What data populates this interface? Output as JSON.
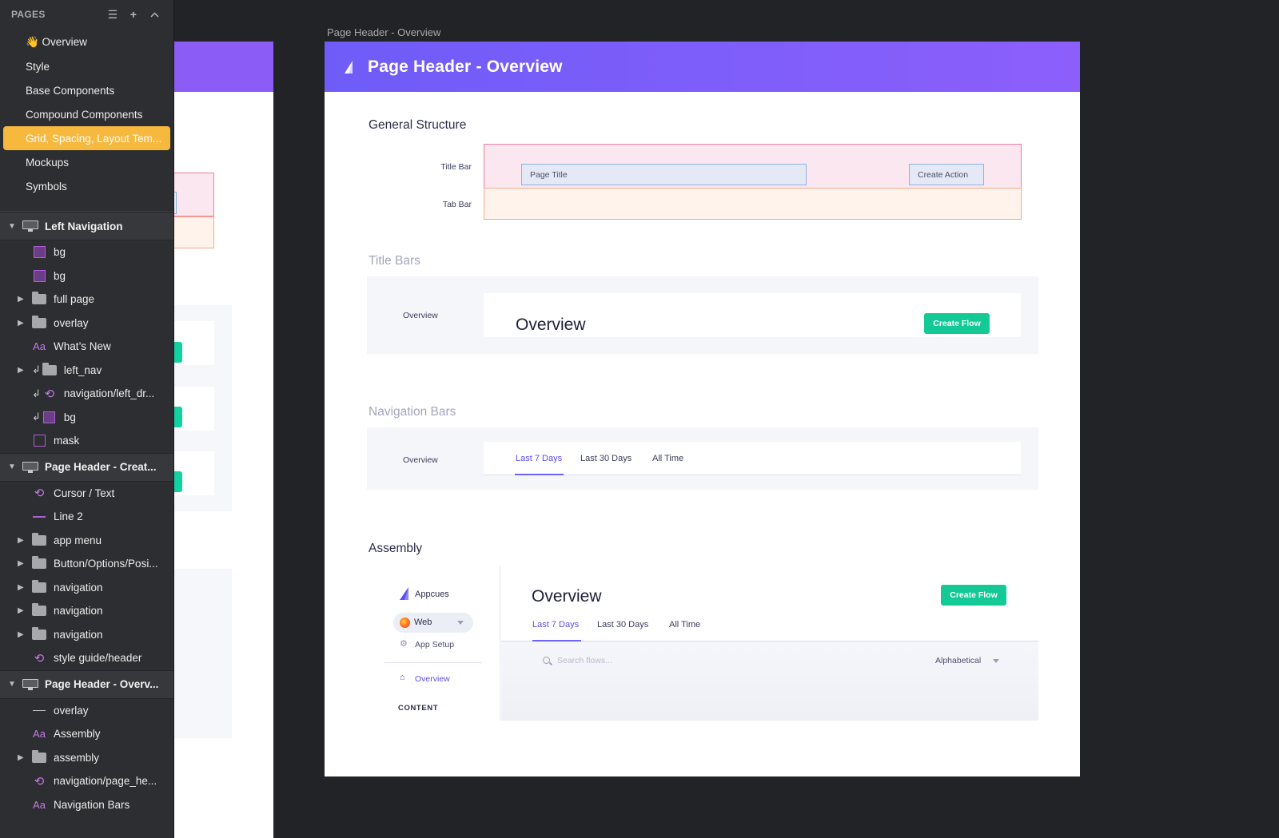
{
  "sidebar": {
    "pages_title": "PAGES",
    "pages": [
      {
        "label": "👋 Overview",
        "active": false
      },
      {
        "label": "Style",
        "active": false
      },
      {
        "label": "Base Components",
        "active": false
      },
      {
        "label": "Compound Components",
        "active": false
      },
      {
        "label": "Grid, Spacing, Layout Tem...",
        "active": true
      },
      {
        "label": "Mockups",
        "active": false
      },
      {
        "label": "Symbols",
        "active": false
      }
    ],
    "groups": [
      {
        "title": "Left Navigation",
        "layers": [
          {
            "label": "bg",
            "icon": "rectangle-icon"
          },
          {
            "label": "bg",
            "icon": "rectangle-icon"
          },
          {
            "label": "full page",
            "icon": "folder-icon"
          },
          {
            "label": "overlay",
            "icon": "folder-icon"
          },
          {
            "label": "What’s New",
            "icon": "text-layer-icon"
          },
          {
            "label": "left_nav",
            "icon": "folder-icon"
          },
          {
            "label": "navigation/left_dr...",
            "icon": "symbol-icon"
          },
          {
            "label": "bg",
            "icon": "rectangle-icon"
          },
          {
            "label": "mask",
            "icon": "rectangle-icon"
          }
        ]
      },
      {
        "title": "Page Header - Creat...",
        "layers": [
          {
            "label": "Cursor / Text",
            "icon": "symbol-icon"
          },
          {
            "label": "Line 2",
            "icon": "line-icon"
          },
          {
            "label": "app menu",
            "icon": "folder-icon"
          },
          {
            "label": "Button/Options/Posi...",
            "icon": "folder-icon"
          },
          {
            "label": "navigation",
            "icon": "folder-icon"
          },
          {
            "label": "navigation",
            "icon": "folder-icon"
          },
          {
            "label": "navigation",
            "icon": "folder-icon"
          },
          {
            "label": "style guide/header",
            "icon": "symbol-icon"
          }
        ]
      },
      {
        "title": "Page Header - Overv...",
        "layers": [
          {
            "label": "overlay",
            "icon": "line-icon"
          },
          {
            "label": "Assembly",
            "icon": "text-layer-icon"
          },
          {
            "label": "assembly",
            "icon": "folder-icon"
          },
          {
            "label": "navigation/page_he...",
            "icon": "symbol-icon"
          },
          {
            "label": "Navigation Bars",
            "icon": "text-layer-icon"
          }
        ]
      }
    ]
  },
  "canvas": {
    "artboard_label": "Page Header - Overview",
    "header_title": "Page Header - Overview",
    "general_structure": {
      "title": "General Structure",
      "title_bar_label": "Title Bar",
      "tab_bar_label": "Tab Bar",
      "page_title_box": "Page Title",
      "create_action_box": "Create Action"
    },
    "title_bars": {
      "title": "Title Bars",
      "row_label": "Overview",
      "heading": "Overview",
      "button": "Create Flow"
    },
    "navigation_bars": {
      "title": "Navigation Bars",
      "row_label": "Overview",
      "tabs": [
        "Last 7 Days",
        "Last 30 Days",
        "All Time"
      ]
    },
    "assembly": {
      "title": "Assembly",
      "brand": "Appcues",
      "platform": "Web",
      "app_setup": "App Setup",
      "nav_overview": "Overview",
      "content_heading": "CONTENT",
      "heading": "Overview",
      "button": "Create Flow",
      "tabs": [
        "Last 7 Days",
        "Last 30 Days",
        "All Time"
      ],
      "search_placeholder": "Search flows...",
      "sort_value": "Alphabetical"
    }
  },
  "colors": {
    "accent_yellow": "#f7b83e",
    "header_purple": "#7b5cf9",
    "button_green": "#13c996",
    "tab_active": "#5a4ff0"
  }
}
